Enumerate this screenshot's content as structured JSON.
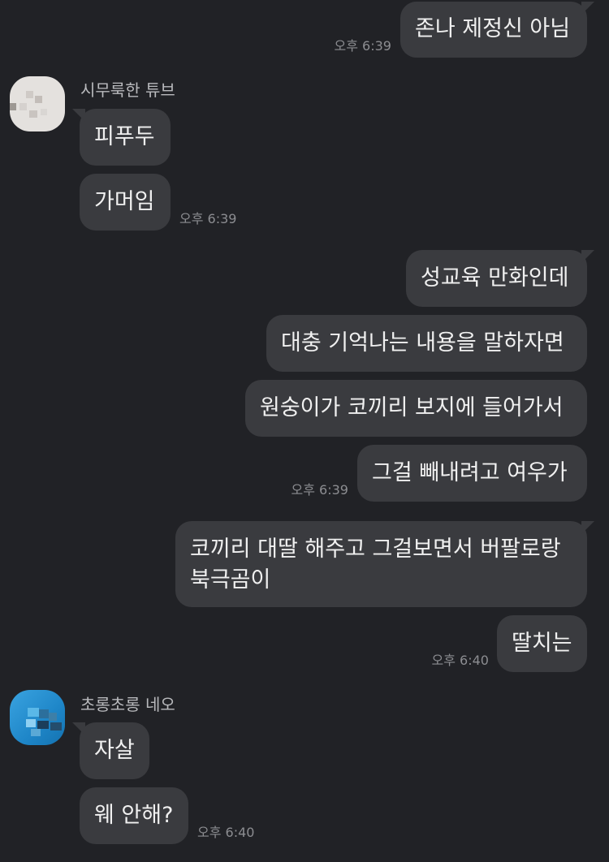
{
  "colors": {
    "background": "#212226",
    "bubble": "#3a3b3f",
    "text": "#f0f0f0",
    "timestamp": "#8c8d91",
    "sender_name": "#b9babd"
  },
  "messages": {
    "m1": {
      "text": "존나 제정신 아님",
      "time": "오후 6:39"
    },
    "sender1": {
      "name": "시무룩한 튜브",
      "avatar_icon": "pixelated-avatar-icon"
    },
    "m2": {
      "text": "피푸두"
    },
    "m3": {
      "text": "가머임",
      "time": "오후 6:39"
    },
    "m4": {
      "text": "성교육 만화인데"
    },
    "m5": {
      "text": "대충 기억나는 내용을 말하자면"
    },
    "m6": {
      "text": "원숭이가 코끼리 보지에 들어가서"
    },
    "m7": {
      "text": "그걸 빼내려고 여우가",
      "time": "오후 6:39"
    },
    "m8": {
      "line1": "코끼리 대딸 해주고 그걸보면서 버팔로랑",
      "line2": "북극곰이"
    },
    "m9": {
      "text": "딸치는",
      "time": "오후 6:40"
    },
    "sender2": {
      "name": "초롱초롱 네오",
      "avatar_icon": "pixelated-avatar-icon"
    },
    "m10": {
      "text": "자살"
    },
    "m11": {
      "text": "웨 안해?",
      "time": "오후 6:40"
    }
  }
}
